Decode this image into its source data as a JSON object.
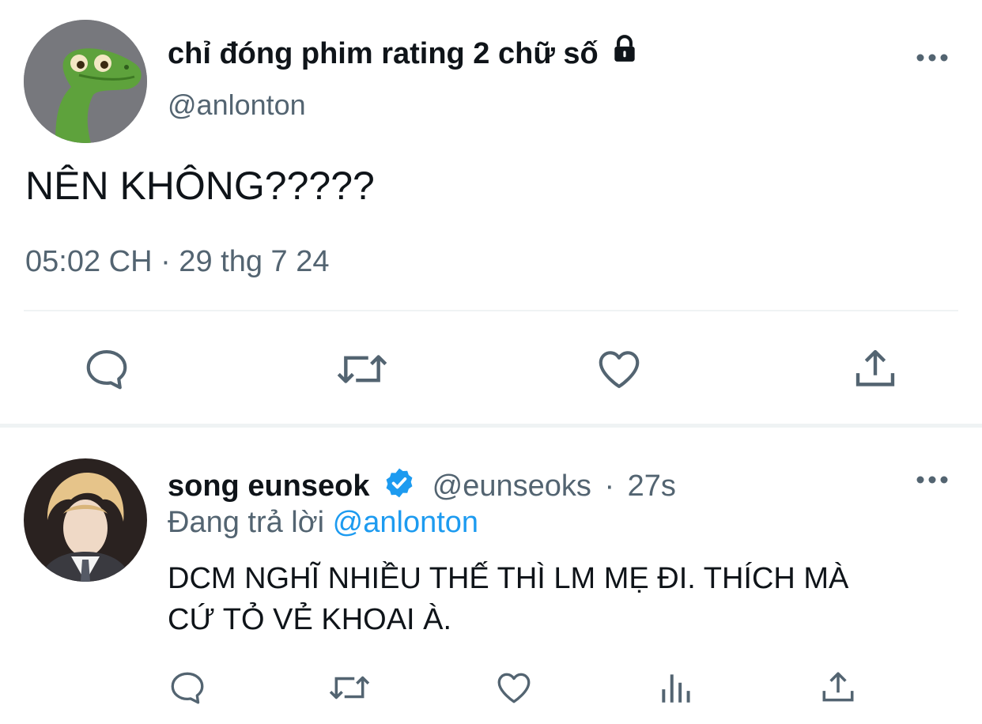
{
  "main_tweet": {
    "display_name": "chỉ đóng phim rating 2 chữ số",
    "handle": "@anlonton",
    "text": "NÊN KHÔNG?????",
    "timestamp": "05:02 CH · 29 thg 7 24",
    "lock_icon": "lock-icon",
    "more_icon": "more-dots-icon",
    "actions": [
      "reply-icon",
      "retweet-icon",
      "like-icon",
      "share-icon"
    ]
  },
  "reply_tweet": {
    "display_name": "song eunseok",
    "handle": "@eunseoks",
    "separator": "·",
    "time": "27s",
    "replying_label": "Đang trả lời",
    "replying_to": "@anlonton",
    "text_line1": "DCM NGHĨ NHIỀU THẾ THÌ LM MẸ ĐI. THÍCH MÀ",
    "text_line2": "CỨ TỎ VẺ KHOAI À.",
    "verified_icon": "verified-badge-icon",
    "more_icon": "more-dots-icon",
    "actions": [
      "reply-icon",
      "retweet-icon",
      "like-icon",
      "analytics-icon",
      "share-icon"
    ]
  },
  "colors": {
    "text": "#0f1419",
    "secondary": "#536471",
    "accent": "#1d9bf0",
    "divider": "#eff3f4"
  }
}
